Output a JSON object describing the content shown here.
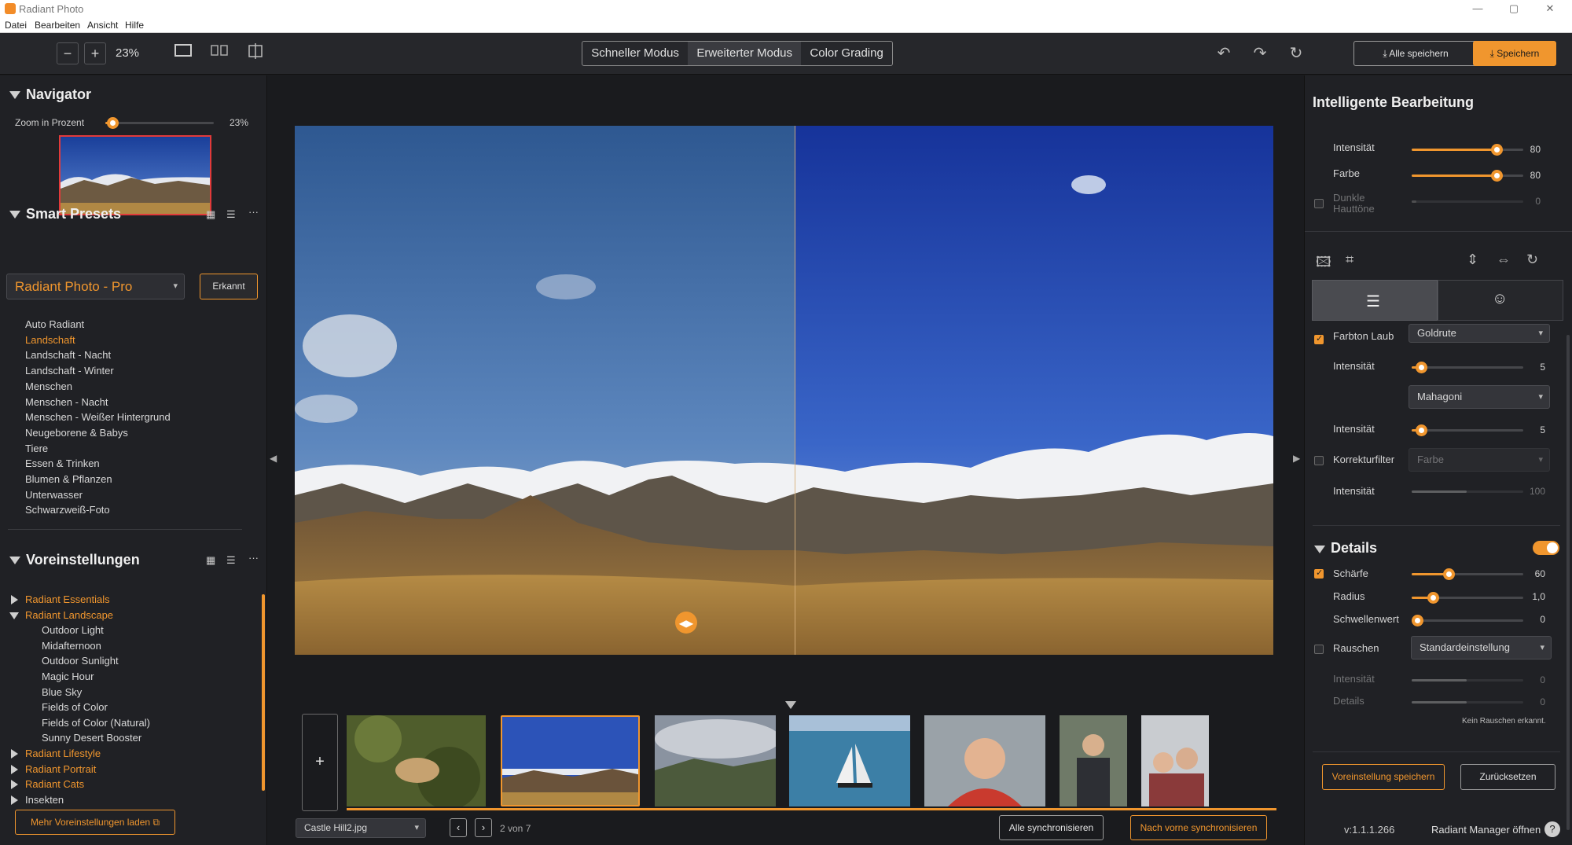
{
  "window": {
    "title": "Radiant Photo",
    "controls": [
      "—",
      "▢",
      "✕"
    ]
  },
  "menu": [
    "Datei",
    "Bearbeiten",
    "Ansicht",
    "Hilfe"
  ],
  "toolbar": {
    "zoom_minus": "−",
    "zoom_plus": "+",
    "zoom_value": "23%",
    "modes": [
      "Schneller Modus",
      "Erweiterter Modus",
      "Color Grading"
    ],
    "save_all": "Alle speichern",
    "save": "Speichern"
  },
  "navigator": {
    "title": "Navigator",
    "zoom_label": "Zoom in Prozent",
    "zoom_value": "23%",
    "zoom_fraction": 0.07
  },
  "smart_presets": {
    "title": "Smart Presets",
    "dropdown_value": "Radiant Photo - Pro",
    "detected_button": "Erkannt",
    "items": [
      "Auto Radiant",
      "Landschaft",
      "Landschaft - Nacht",
      "Landschaft - Winter",
      "Menschen",
      "Menschen - Nacht",
      "Menschen - Weißer Hintergrund",
      "Neugeborene & Babys",
      "Tiere",
      "Essen & Trinken",
      "Blumen & Pflanzen",
      "Unterwasser",
      "Schwarzweiß-Foto"
    ],
    "selected": "Landschaft"
  },
  "presets": {
    "title": "Voreinstellungen",
    "groups": [
      {
        "label": "Radiant Essentials",
        "open": false
      },
      {
        "label": "Radiant Landscape",
        "open": true,
        "children": [
          "Outdoor Light",
          "Midafternoon",
          "Outdoor Sunlight",
          "Magic Hour",
          "Blue Sky",
          "Fields of Color",
          "Fields of Color (Natural)",
          "Sunny Desert Booster"
        ]
      },
      {
        "label": "Radiant Lifestyle",
        "open": false
      },
      {
        "label": "Radiant Portrait",
        "open": false
      },
      {
        "label": "Radiant Cats",
        "open": false
      },
      {
        "label": "Insekten",
        "open": false
      }
    ],
    "load_more": "Mehr Voreinstellungen laden"
  },
  "filmstrip": {
    "add": "+",
    "file_name": "Castle Hill2.jpg",
    "counter": "2 von 7",
    "sync_all": "Alle synchronisieren",
    "sync_forward": "Nach vorne synchronisieren"
  },
  "smart_edit": {
    "title": "Intelligente Bearbeitung",
    "intensity_label": "Intensität",
    "intensity_value": "80",
    "color_label": "Farbe",
    "color_value": "80",
    "dark_skin_label_1": "Dunkle",
    "dark_skin_label_2": "Hauttöne",
    "dark_skin_value": "0"
  },
  "adjust": {
    "foliage_label": "Farbton Laub",
    "foliage_value": "Goldrute",
    "intensity_label": "Intensität",
    "intensity1_value": "5",
    "mahogany": "Mahagoni",
    "intensity2_value": "5",
    "filter_label": "Korrekturfilter",
    "filter_value": "Farbe",
    "intensity3_value": "100"
  },
  "details": {
    "title": "Details",
    "sharpness_label": "Schärfe",
    "sharpness_value": "60",
    "radius_label": "Radius",
    "radius_value": "1,0",
    "threshold_label": "Schwellenwert",
    "threshold_value": "0",
    "noise_label": "Rauschen",
    "noise_value": "Standardeinstellung",
    "noise_intensity_label": "Intensität",
    "noise_intensity_value": "0",
    "noise_details_label": "Details",
    "noise_details_value": "0",
    "no_noise": "Kein Rauschen erkannt."
  },
  "footer": {
    "save_preset": "Voreinstellung speichern",
    "reset": "Zurücksetzen",
    "version": "v:1.1.1.266",
    "manager": "Radiant Manager öffnen",
    "help": "?"
  },
  "colors": {
    "accent": "#f0962e",
    "panel": "#202125",
    "background": "#1a1b1e"
  }
}
